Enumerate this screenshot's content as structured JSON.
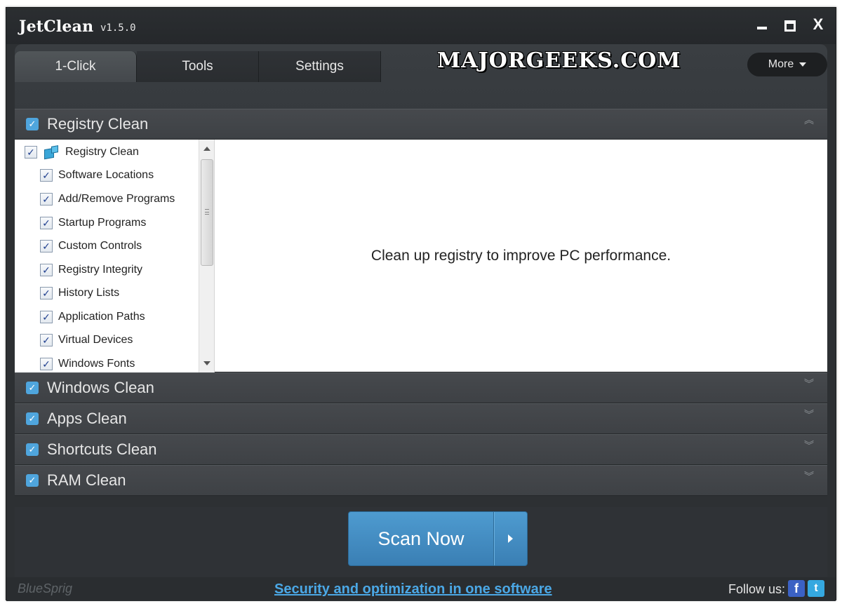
{
  "window": {
    "title": "JetClean",
    "version": "v1.5.0",
    "controls": {
      "minimize": "minimize",
      "maximize": "maximize",
      "close": "X"
    }
  },
  "tabs": [
    {
      "label": "1-Click",
      "active": true
    },
    {
      "label": "Tools",
      "active": false
    },
    {
      "label": "Settings",
      "active": false
    }
  ],
  "watermark": "MAJORGEEKS.COM",
  "more_button": "More",
  "sections": {
    "registry": {
      "label": "Registry Clean",
      "checked": true,
      "expanded": true,
      "description": "Clean up registry to improve PC performance.",
      "tree_root": "Registry Clean",
      "items": [
        "Software Locations",
        "Add/Remove Programs",
        "Startup Programs",
        "Custom Controls",
        "Registry Integrity",
        "History Lists",
        "Application Paths",
        "Virtual Devices",
        "Windows Fonts"
      ]
    },
    "collapsed": [
      {
        "label": "Windows Clean",
        "checked": true
      },
      {
        "label": "Apps Clean",
        "checked": true
      },
      {
        "label": "Shortcuts Clean",
        "checked": true
      },
      {
        "label": "RAM Clean",
        "checked": true
      }
    ]
  },
  "scan_button": "Scan Now",
  "footer": {
    "brand": "BlueSprig",
    "link": "Security and optimization in one software",
    "follow_label": "Follow us:",
    "social": {
      "facebook": "f",
      "twitter": "t"
    }
  },
  "colors": {
    "window_bg": "#2d3033",
    "accent_blue": "#4fa5dd",
    "scan_button": "#4e9bd0",
    "link": "#4ba8e6"
  },
  "icons": {
    "checkmark": "check-icon",
    "collapse": "chevron-up-double-icon",
    "expand": "chevron-down-double-icon"
  }
}
